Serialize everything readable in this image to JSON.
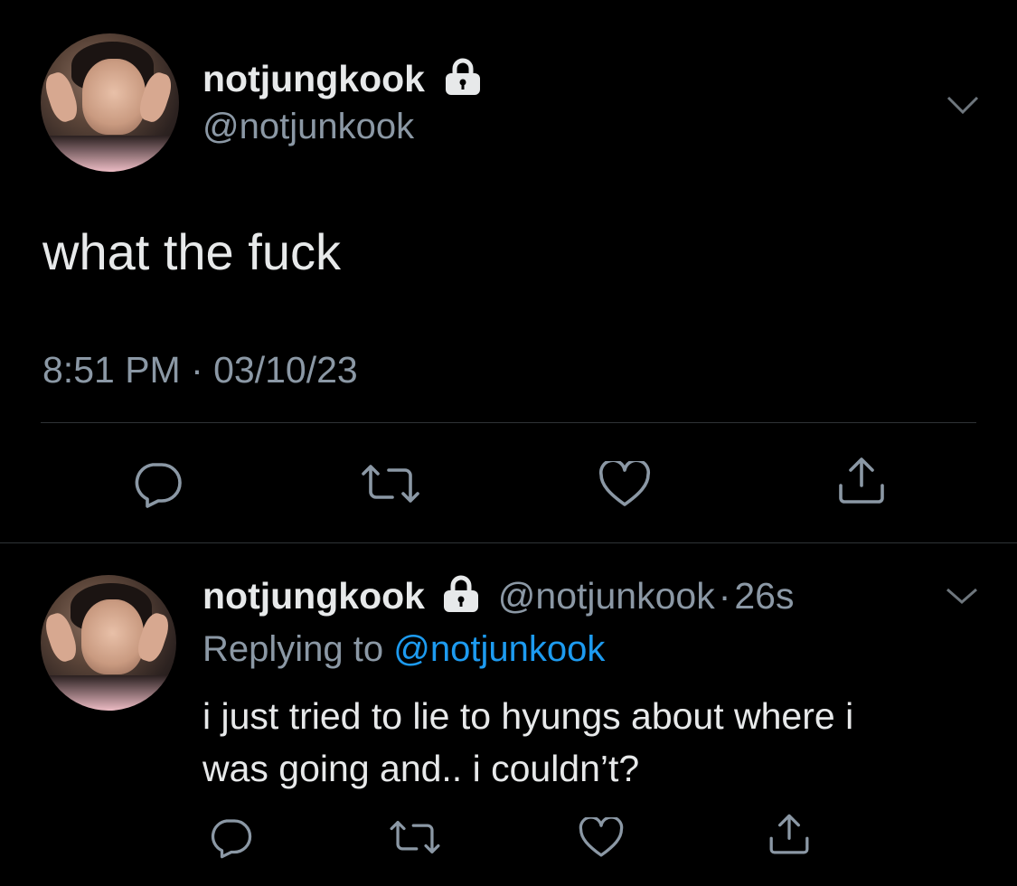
{
  "main_tweet": {
    "display_name": "notjungkook",
    "handle": "@notjunkook",
    "text": "what the fuck",
    "timestamp": "8:51 PM · 03/10/23",
    "avatar_icon": "avatar-photo",
    "protected_icon": "lock-icon",
    "menu_icon": "chevron-down-icon",
    "actions": [
      "reply-icon",
      "retweet-icon",
      "like-icon",
      "share-icon"
    ]
  },
  "reply_tweet": {
    "display_name": "notjungkook",
    "handle": "@notjunkook",
    "separator": "·",
    "age": "26s",
    "replying_prefix": "Replying to",
    "replying_to": "@notjunkook",
    "text_line1": "i just tried to lie to hyungs about where i",
    "text_line2": "was going and.. i couldn’t?",
    "avatar_icon": "avatar-photo",
    "protected_icon": "lock-icon",
    "menu_icon": "chevron-down-icon",
    "actions": [
      "reply-icon",
      "retweet-icon",
      "like-icon",
      "share-icon"
    ]
  },
  "colors": {
    "background": "#000000",
    "text": "#e7e9ea",
    "muted": "#8b98a5",
    "link": "#1d9bf0",
    "divider": "#2f3336"
  }
}
